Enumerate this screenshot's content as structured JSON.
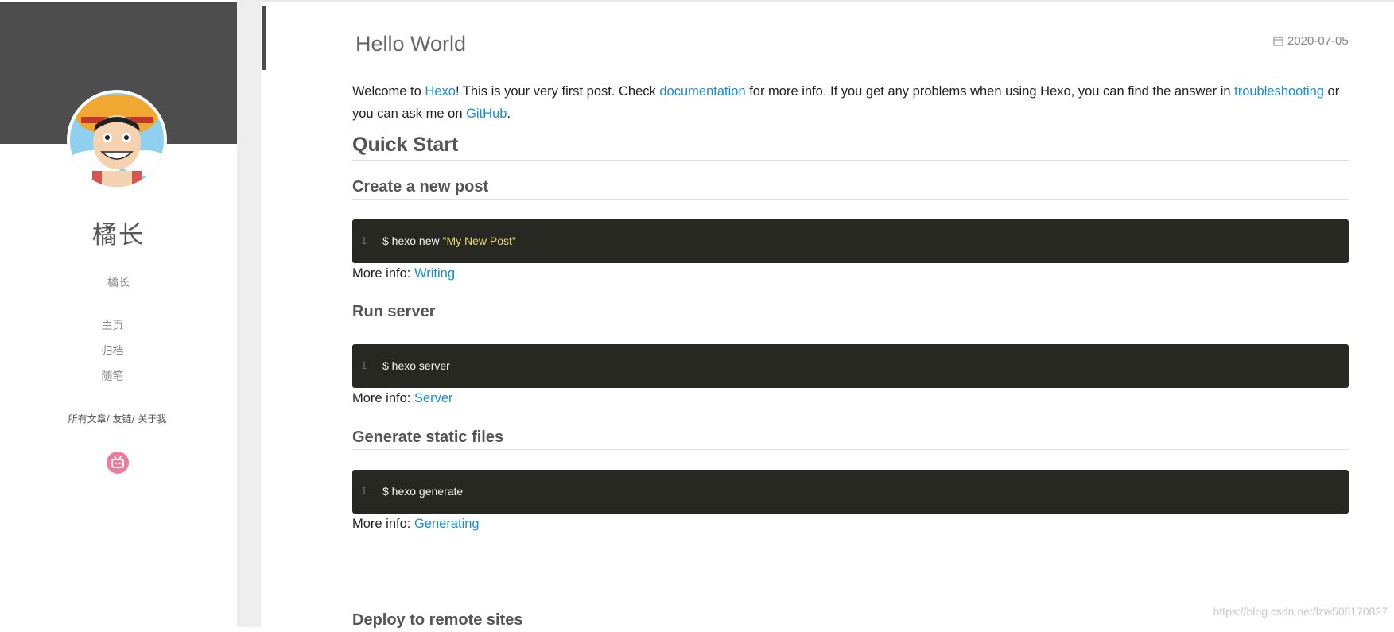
{
  "sidebar": {
    "blog_name": "橘长",
    "subtitle": "橘长",
    "nav": [
      "主页",
      "归档",
      "随笔"
    ],
    "links": [
      "所有文章",
      "友链",
      "关于我"
    ],
    "avatar_alt": "avatar",
    "bili_icon": "bilibili-icon"
  },
  "post": {
    "title": "Hello World",
    "date": "2020-07-05",
    "intro": {
      "t1": "Welcome to ",
      "l1": "Hexo",
      "t2": "! This is your very first post. Check ",
      "l2": "documentation",
      "t3": " for more info. If you get any problems when using Hexo, you can find the answer in ",
      "l3": "troubleshooting",
      "t4": " or you can ask me on ",
      "l4": "GitHub",
      "t5": "."
    },
    "h_quick": "Quick Start",
    "sections": [
      {
        "heading": "Create a new post",
        "line": "1",
        "cmd": "$ hexo new ",
        "arg": "\"My New Post\"",
        "more_label": "More info: ",
        "more_link": "Writing"
      },
      {
        "heading": "Run server",
        "line": "1",
        "cmd": "$ hexo server",
        "arg": "",
        "more_label": "More info: ",
        "more_link": "Server"
      },
      {
        "heading": "Generate static files",
        "line": "1",
        "cmd": "$ hexo generate",
        "arg": "",
        "more_label": "More info: ",
        "more_link": "Generating"
      },
      {
        "heading": "Deploy to remote sites"
      }
    ]
  },
  "watermark": "https://blog.csdn.net/lzw508170827",
  "colors": {
    "link": "#1a8ccc",
    "code_bg": "#272822",
    "sidebar_banner": "#4d4d4d",
    "bilibili": "#ef7b9c"
  }
}
